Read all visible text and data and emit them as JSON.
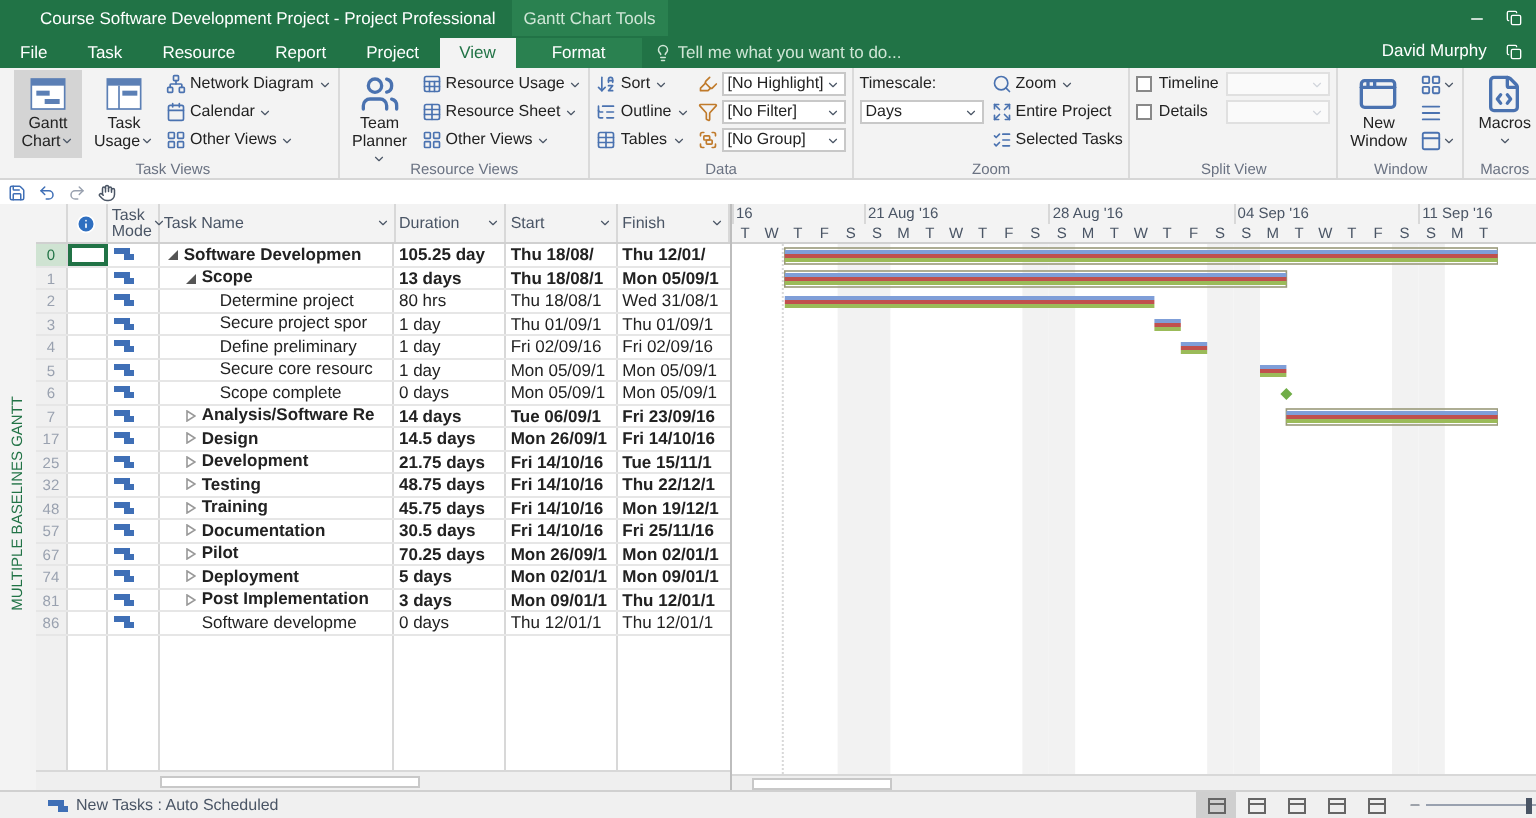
{
  "window": {
    "title": "Course Software Development Project - Project Professional",
    "context_title": "Gantt Chart Tools",
    "user": "David Murphy"
  },
  "tabs": [
    {
      "label": "File",
      "selected": false
    },
    {
      "label": "Task",
      "selected": false
    },
    {
      "label": "Resource",
      "selected": false
    },
    {
      "label": "Report",
      "selected": false
    },
    {
      "label": "Project",
      "selected": false
    },
    {
      "label": "View",
      "selected": true
    },
    {
      "label": "Format",
      "selected": false
    }
  ],
  "tell_me": {
    "placeholder": "Tell me what you want to do..."
  },
  "ribbon": [
    {
      "label": "Task Views",
      "columns": [
        [
          {
            "kind": "large",
            "label": "Gantt Chart",
            "menu": true,
            "selected": true
          }
        ],
        [
          {
            "kind": "large",
            "label": "Task Usage",
            "menu": true,
            "selected": false
          }
        ],
        [
          {
            "kind": "small",
            "label": "Network Diagram",
            "menu": true
          },
          {
            "kind": "small",
            "label": "Calendar",
            "menu": true
          },
          {
            "kind": "small",
            "label": "Other Views",
            "menu": true
          }
        ]
      ]
    },
    {
      "label": "Resource Views",
      "columns": [
        [
          {
            "kind": "large",
            "label": "Team Planner",
            "menu": true,
            "selected": false
          }
        ],
        [
          {
            "kind": "small",
            "label": "Resource Usage",
            "menu": true
          },
          {
            "kind": "small",
            "label": "Resource Sheet",
            "menu": true
          },
          {
            "kind": "small",
            "label": "Other Views",
            "menu": true
          }
        ]
      ]
    },
    {
      "label": "Data",
      "columns": [
        [
          {
            "kind": "small",
            "label": "Sort",
            "menu": true
          },
          {
            "kind": "small",
            "label": "Outline",
            "menu": true
          },
          {
            "kind": "small",
            "label": "Tables",
            "menu": true
          }
        ],
        [
          {
            "kind": "select",
            "value": "[No Highlight]"
          },
          {
            "kind": "select",
            "value": "[No Filter]"
          },
          {
            "kind": "select",
            "value": "[No Group]"
          }
        ]
      ]
    },
    {
      "label": "Zoom",
      "columns": [
        [
          {
            "kind": "text",
            "label": "Timescale:"
          },
          {
            "kind": "select",
            "value": "Days"
          }
        ],
        [
          {
            "kind": "small",
            "label": "Zoom",
            "menu": true
          },
          {
            "kind": "small",
            "label": "Entire Project",
            "menu": false
          },
          {
            "kind": "small",
            "label": "Selected Tasks",
            "menu": false
          }
        ]
      ]
    },
    {
      "label": "Split View",
      "columns": [
        [
          {
            "kind": "checkbox",
            "label": "Timeline",
            "checked": false
          },
          {
            "kind": "checkbox",
            "label": "Details",
            "checked": false
          }
        ],
        [
          {
            "kind": "select",
            "disabled": true
          },
          {
            "kind": "select",
            "disabled": true
          }
        ]
      ]
    },
    {
      "label": "Window",
      "columns": [
        [
          {
            "kind": "large",
            "label": "New Window",
            "menu": false,
            "selected": false
          }
        ],
        [
          {
            "kind": "icon",
            "menu": true
          },
          {
            "kind": "icon",
            "menu": false
          },
          {
            "kind": "icon",
            "menu": true
          }
        ]
      ]
    },
    {
      "label": "Macros",
      "columns": [
        [
          {
            "kind": "large",
            "label": "Macros",
            "menu": true,
            "selected": false
          }
        ]
      ]
    }
  ],
  "side_label": "MULTIPLE BASELINES GANTT",
  "table": {
    "columns": [
      "Task Mode",
      "Task Name",
      "Duration",
      "Start",
      "Finish"
    ],
    "tasks": [
      {
        "id": "0",
        "name": "Software Developmen",
        "duration": "105.25 day",
        "start": "Thu 18/08/",
        "finish": "Thu 12/01/",
        "summary": true,
        "expanded": true,
        "selected": true,
        "children": [
          {
            "id": "1",
            "name": "Scope",
            "duration": "13 days",
            "start": "Thu 18/08/1",
            "finish": "Mon 05/09/1",
            "summary": true,
            "expanded": true,
            "selected": false,
            "children": [
              {
                "id": "2",
                "name": "Determine project",
                "duration": "80 hrs",
                "start": "Thu 18/08/1",
                "finish": "Wed 31/08/1",
                "summary": false,
                "selected": false
              },
              {
                "id": "3",
                "name": "Secure project spor",
                "duration": "1 day",
                "start": "Thu 01/09/1",
                "finish": "Thu 01/09/1",
                "summary": false,
                "selected": false
              },
              {
                "id": "4",
                "name": "Define preliminary",
                "duration": "1 day",
                "start": "Fri 02/09/16",
                "finish": "Fri 02/09/16",
                "summary": false,
                "selected": false
              },
              {
                "id": "5",
                "name": "Secure core resourc",
                "duration": "1 day",
                "start": "Mon 05/09/1",
                "finish": "Mon 05/09/1",
                "summary": false,
                "selected": false
              },
              {
                "id": "6",
                "name": "Scope complete",
                "duration": "0 days",
                "start": "Mon 05/09/1",
                "finish": "Mon 05/09/1",
                "summary": false,
                "selected": false
              }
            ]
          },
          {
            "id": "7",
            "name": "Analysis/Software Re",
            "duration": "14 days",
            "start": "Tue 06/09/1",
            "finish": "Fri 23/09/16",
            "summary": true,
            "expanded": false,
            "selected": false
          },
          {
            "id": "17",
            "name": "Design",
            "duration": "14.5 days",
            "start": "Mon 26/09/1",
            "finish": "Fri 14/10/16",
            "summary": true,
            "expanded": false,
            "selected": false
          },
          {
            "id": "25",
            "name": "Development",
            "duration": "21.75 days",
            "start": "Fri 14/10/16",
            "finish": "Tue 15/11/1",
            "summary": true,
            "expanded": false,
            "selected": false
          },
          {
            "id": "32",
            "name": "Testing",
            "duration": "48.75 days",
            "start": "Fri 14/10/16",
            "finish": "Thu 22/12/1",
            "summary": true,
            "expanded": false,
            "selected": false
          },
          {
            "id": "48",
            "name": "Training",
            "duration": "45.75 days",
            "start": "Fri 14/10/16",
            "finish": "Mon 19/12/1",
            "summary": true,
            "expanded": false,
            "selected": false
          },
          {
            "id": "57",
            "name": "Documentation",
            "duration": "30.5 days",
            "start": "Fri 14/10/16",
            "finish": "Fri 25/11/16",
            "summary": true,
            "expanded": false,
            "selected": false
          },
          {
            "id": "67",
            "name": "Pilot",
            "duration": "70.25 days",
            "start": "Mon 26/09/1",
            "finish": "Mon 02/01/1",
            "summary": true,
            "expanded": false,
            "selected": false
          },
          {
            "id": "74",
            "name": "Deployment",
            "duration": "5 days",
            "start": "Mon 02/01/1",
            "finish": "Mon 09/01/1",
            "summary": true,
            "expanded": false,
            "selected": false
          },
          {
            "id": "81",
            "name": "Post Implementation",
            "duration": "3 days",
            "start": "Mon 09/01/1",
            "finish": "Thu 12/01/1",
            "summary": true,
            "expanded": false,
            "selected": false
          },
          {
            "id": "86",
            "name": "Software developme",
            "duration": "0 days",
            "start": "Thu 12/01/1",
            "finish": "Thu 12/01/1",
            "summary": false,
            "selected": false
          }
        ]
      }
    ]
  },
  "timescale": {
    "weeks": [
      "16",
      "21 Aug '16",
      "28 Aug '16",
      "04 Sep '16",
      "11 Sep '16"
    ],
    "days": [
      "T",
      "W",
      "T",
      "F",
      "S",
      "S",
      "M",
      "T",
      "W",
      "T",
      "F",
      "S",
      "S",
      "M",
      "T",
      "W",
      "T",
      "F",
      "S",
      "S",
      "M",
      "T",
      "W",
      "T",
      "F",
      "S",
      "S",
      "M",
      "T"
    ]
  },
  "status_bar": {
    "text": "New Tasks : Auto Scheduled",
    "view_buttons": [
      {
        "selected": true
      },
      {
        "selected": false
      },
      {
        "selected": false
      },
      {
        "selected": false
      },
      {
        "selected": false
      }
    ],
    "zoom": {
      "level": 0.85
    }
  }
}
